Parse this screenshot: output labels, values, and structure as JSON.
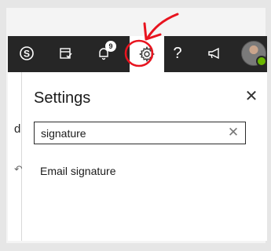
{
  "toolbar": {
    "icons": [
      {
        "name": "skype-icon"
      },
      {
        "name": "my-day-icon"
      },
      {
        "name": "notifications-icon"
      },
      {
        "name": "settings-icon"
      },
      {
        "name": "help-icon"
      },
      {
        "name": "feedback-icon"
      }
    ],
    "notification_count": "9",
    "help_glyph": "?",
    "presence_color": "#6bb700"
  },
  "settings_panel": {
    "title": "Settings",
    "close_glyph": "✕",
    "search": {
      "value": "signature",
      "clear_glyph": "✕"
    },
    "results": [
      {
        "label": "Email signature"
      }
    ]
  },
  "left_pane": {
    "letter": "d",
    "glyph": "↶"
  },
  "colors": {
    "topbar": "#262626",
    "annotation_red": "#e8141f",
    "presence": "#6bb700"
  }
}
